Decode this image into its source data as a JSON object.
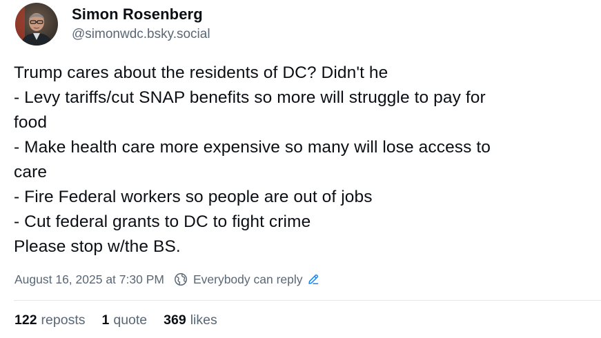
{
  "author": {
    "display_name": "Simon Rosenberg",
    "handle": "@simonwdc.bsky.social",
    "avatar_icon": "person-avatar-icon"
  },
  "post": {
    "lines": [
      "Trump cares about the residents of DC? Didn't he",
      "- Levy tariffs/cut SNAP benefits so more will struggle to pay for",
      "food",
      "- Make health care more expensive so many will lose access to",
      "care",
      "- Fire Federal workers so people are out of jobs",
      "- Cut federal grants to DC to fight crime",
      "Please stop w/the BS."
    ]
  },
  "meta": {
    "timestamp": "August 16, 2025 at 7:30 PM",
    "reply_setting": "Everybody can reply",
    "reply_icon": "globe-icon",
    "edit_icon": "pencil-icon"
  },
  "stats": {
    "reposts_count": "122",
    "reposts_label": "reposts",
    "quotes_count": "1",
    "quotes_label": "quote",
    "likes_count": "369",
    "likes_label": "likes"
  },
  "colors": {
    "text": "#0b0f14",
    "muted": "#5a6775",
    "accent": "#1083fe",
    "divider": "#e4e8ec"
  }
}
